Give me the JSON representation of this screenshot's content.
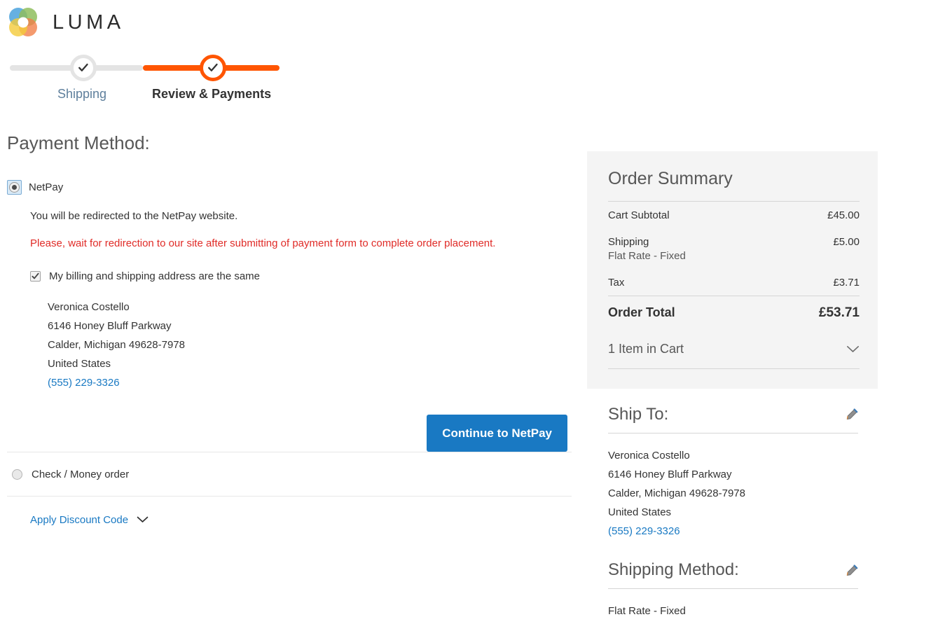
{
  "brand": {
    "name": "LUMA",
    "logo_icon": "luma-rings-logo"
  },
  "progress": {
    "steps": [
      {
        "label": "Shipping",
        "state": "completed",
        "icon": "check-icon"
      },
      {
        "label": "Review & Payments",
        "state": "active",
        "icon": "check-icon"
      }
    ]
  },
  "payment": {
    "page_title": "Payment Method:",
    "methods": [
      {
        "id": "netpay",
        "label": "NetPay",
        "selected": true,
        "redirect_note": "You will be redirected to the NetPay website.",
        "warning": "Please, wait for redirection to our site after submitting of payment form to complete order placement.",
        "billing_same_label": "My billing and shipping address are the same",
        "billing_same_checked": true,
        "continue_button": "Continue to NetPay"
      },
      {
        "id": "checkmo",
        "label": "Check / Money order",
        "selected": false
      }
    ],
    "billing_address": {
      "name": "Veronica Costello",
      "street": "6146 Honey Bluff Parkway",
      "city_state_zip": "Calder, Michigan 49628-7978",
      "country": "United States",
      "phone": "(555) 229-3326"
    },
    "discount": {
      "label": "Apply Discount Code",
      "icon": "chevron-down-icon",
      "expanded": false
    }
  },
  "order_summary": {
    "title": "Order Summary",
    "rows": [
      {
        "label": "Cart Subtotal",
        "sub": "",
        "amount": "£45.00"
      },
      {
        "label": "Shipping",
        "sub": "Flat Rate - Fixed",
        "amount": "£5.00"
      },
      {
        "label": "Tax",
        "sub": "",
        "amount": "£3.71"
      }
    ],
    "total_label": "Order Total",
    "total_amount": "£53.71",
    "cart_items_label": "1 Item in Cart",
    "cart_items_icon": "chevron-down-icon"
  },
  "ship_to": {
    "title": "Ship To:",
    "edit_icon": "pencil-icon",
    "name": "Veronica Costello",
    "street": "6146 Honey Bluff Parkway",
    "city_state_zip": "Calder, Michigan 49628-7978",
    "country": "United States",
    "phone": "(555) 229-3326"
  },
  "shipping_method": {
    "title": "Shipping Method:",
    "edit_icon": "pencil-icon",
    "value": "Flat Rate - Fixed"
  },
  "colors": {
    "accent_orange": "#ff5501",
    "link_blue": "#1979c3",
    "error_red": "#e02b27",
    "panel_gray": "#f4f4f4"
  }
}
